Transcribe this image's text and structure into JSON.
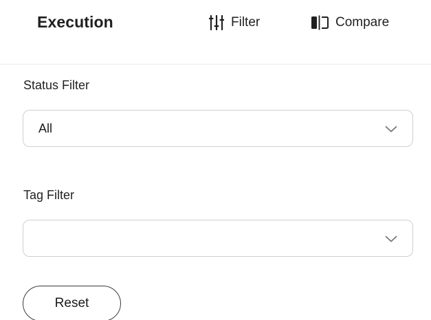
{
  "header": {
    "title": "Execution",
    "filter_label": "Filter",
    "filter_icon": "sliders-icon",
    "compare_label": "Compare",
    "compare_icon": "compare-columns-icon"
  },
  "status_filter": {
    "label": "Status Filter",
    "selected_value": "All"
  },
  "tag_filter": {
    "label": "Tag Filter",
    "selected_value": ""
  },
  "actions": {
    "reset_label": "Reset"
  },
  "colors": {
    "text": "#1f1f1f",
    "border": "#cfcfcf",
    "divider": "#ececec",
    "chevron": "#777777"
  }
}
